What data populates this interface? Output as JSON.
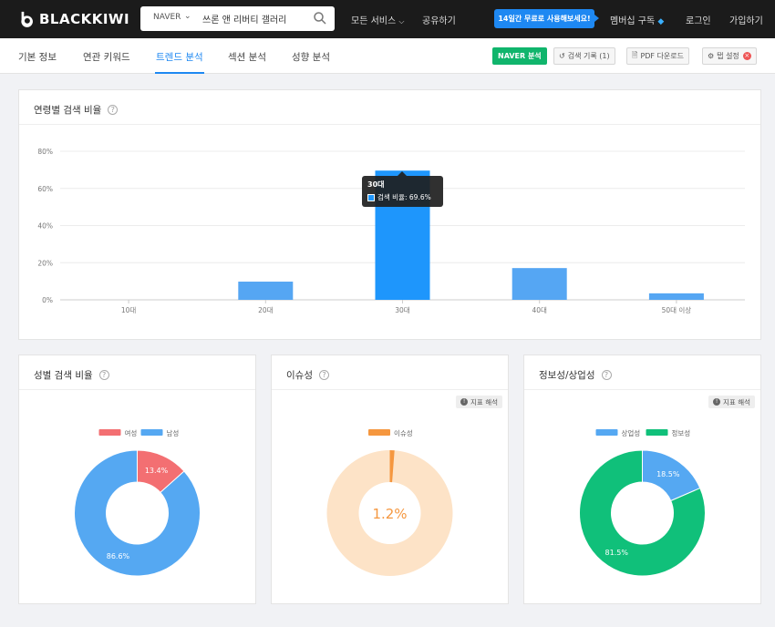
{
  "header": {
    "logo": "BLACKKIWI",
    "search_engine": "NAVER",
    "search_value": "쓰론 앤 리버티 갤러리",
    "menu_services": "모든 서비스",
    "menu_share": "공유하기",
    "promo": "14일간 무료로 사용해보세요!",
    "menu_membership": "멤버십 구독",
    "menu_login": "로그인",
    "menu_signup": "가입하기"
  },
  "nav": {
    "tabs": [
      "기본 정보",
      "연관 키워드",
      "트렌드 분석",
      "섹션 분석",
      "성향 분석"
    ],
    "active_tab": "트렌드 분석",
    "naver_button": "NAVER 분석",
    "history_button": "검색 기록 (1)",
    "pdf_button": "PDF 다운로드",
    "settings_button": "탭 설정"
  },
  "age_card": {
    "title": "연령별 검색 비율"
  },
  "gender_card": {
    "title": "성별 검색 비율"
  },
  "issue_card": {
    "title": "이슈성",
    "hint": "지표 해석"
  },
  "info_card": {
    "title": "정보성/상업성",
    "hint": "지표 해석"
  },
  "tooltip": {
    "title": "30대",
    "series": "검색 비율",
    "value_text": "69.6%"
  },
  "colors": {
    "brand_blue": "#1e88f2",
    "bar_highlight": "#1e96fc",
    "bar_normal": "#55a6f3",
    "female": "#f36f72",
    "male": "#55a8f2",
    "issue": "#f5973f",
    "issue_bg": "#fde3c7",
    "commercial": "#55a8f2",
    "informational": "#10c07a",
    "naver_green": "#10b56c"
  },
  "chart_data": [
    {
      "type": "bar",
      "title": "연령별 검색 비율",
      "categories": [
        "10대",
        "20대",
        "30대",
        "40대",
        "50대 이상"
      ],
      "series": [
        {
          "name": "검색 비율",
          "values": [
            0,
            9.8,
            69.6,
            17.1,
            3.5
          ]
        }
      ],
      "ylim": [
        0,
        80
      ],
      "yticks": [
        0,
        20,
        40,
        60,
        80
      ],
      "ytick_labels": [
        "0%",
        "20%",
        "40%",
        "60%",
        "80%"
      ],
      "highlighted": "30대",
      "grid": true
    },
    {
      "type": "pie",
      "title": "성별 검색 비율",
      "labels": [
        "여성",
        "남성"
      ],
      "values": [
        13.4,
        86.6
      ],
      "value_labels": [
        "13.4%",
        "86.6%"
      ],
      "colors": [
        "#f36f72",
        "#55a8f2"
      ],
      "legend": "top"
    },
    {
      "type": "pie",
      "title": "이슈성",
      "labels": [
        "이슈성"
      ],
      "values": [
        1.2
      ],
      "value_labels": [
        "1.2%"
      ],
      "colors": [
        "#f5973f"
      ],
      "legend": "top"
    },
    {
      "type": "pie",
      "title": "정보성/상업성",
      "labels": [
        "상업성",
        "정보성"
      ],
      "values": [
        18.5,
        81.5
      ],
      "value_labels": [
        "18.5%",
        "81.5%"
      ],
      "colors": [
        "#55a8f2",
        "#10c07a"
      ],
      "legend": "top"
    }
  ]
}
